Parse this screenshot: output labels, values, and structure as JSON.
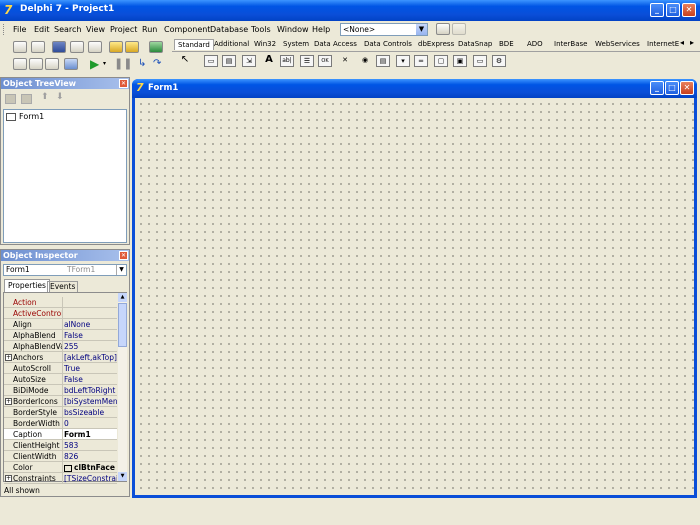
{
  "window": {
    "title": "Delphi 7 - Project1",
    "controls": [
      "_",
      "□",
      "X"
    ]
  },
  "menu": [
    "File",
    "Edit",
    "Search",
    "View",
    "Project",
    "Run",
    "Component",
    "Database",
    "Tools",
    "Window",
    "Help"
  ],
  "config_combo": {
    "value": "<None>"
  },
  "palette": {
    "tabs": [
      "Standard",
      "Additional",
      "Win32",
      "System",
      "Data Access",
      "Data Controls",
      "dbExpress",
      "DataSnap",
      "BDE",
      "ADO",
      "InterBase",
      "WebServices",
      "InternetExpress"
    ],
    "active_tab": "Standard",
    "icons": [
      "pointer-icon",
      "frames-icon",
      "mainmenu-icon",
      "popupmenu-icon",
      "label-icon",
      "edit-icon",
      "memo-icon",
      "button-icon",
      "checkbox-icon",
      "radiobutton-icon",
      "listbox-icon",
      "combobox-icon",
      "scrollbar-icon",
      "groupbox-icon",
      "radiogroup-icon",
      "panel-icon",
      "actionlist-icon"
    ],
    "icon_glyphs": [
      "↖",
      "▭",
      "▤",
      "⇲",
      "A",
      "ab|",
      "☰",
      "OK",
      "✕",
      "◉",
      "▤",
      "▾",
      "═",
      "▢",
      "▣",
      "▭",
      "⚙"
    ]
  },
  "tree_view": {
    "title": "Object TreeView",
    "items": [
      "Form1"
    ]
  },
  "inspector": {
    "title": "Object Inspector",
    "object_name": "Form1",
    "object_class": "TForm1",
    "tabs": [
      "Properties",
      "Events"
    ],
    "active_tab": "Properties",
    "properties": [
      {
        "name": "Action",
        "value": "",
        "event": true,
        "expander": false,
        "bold": false
      },
      {
        "name": "ActiveControl",
        "value": "",
        "event": true,
        "expander": false,
        "bold": false
      },
      {
        "name": "Align",
        "value": "alNone",
        "event": false,
        "expander": false,
        "bold": false
      },
      {
        "name": "AlphaBlend",
        "value": "False",
        "event": false,
        "expander": false,
        "bold": false
      },
      {
        "name": "AlphaBlendValu",
        "value": "255",
        "event": false,
        "expander": false,
        "bold": false
      },
      {
        "name": "Anchors",
        "value": "[akLeft,akTop]",
        "event": false,
        "expander": true,
        "bold": false
      },
      {
        "name": "AutoScroll",
        "value": "True",
        "event": false,
        "expander": false,
        "bold": false
      },
      {
        "name": "AutoSize",
        "value": "False",
        "event": false,
        "expander": false,
        "bold": false
      },
      {
        "name": "BiDiMode",
        "value": "bdLeftToRight",
        "event": false,
        "expander": false,
        "bold": false
      },
      {
        "name": "BorderIcons",
        "value": "[biSystemMenu,",
        "event": false,
        "expander": true,
        "bold": false
      },
      {
        "name": "BorderStyle",
        "value": "bsSizeable",
        "event": false,
        "expander": false,
        "bold": false
      },
      {
        "name": "BorderWidth",
        "value": "0",
        "event": false,
        "expander": false,
        "bold": false
      },
      {
        "name": "Caption",
        "value": "Form1",
        "event": false,
        "expander": false,
        "bold": true
      },
      {
        "name": "ClientHeight",
        "value": "583",
        "event": false,
        "expander": false,
        "bold": false
      },
      {
        "name": "ClientWidth",
        "value": "826",
        "event": false,
        "expander": false,
        "bold": false
      },
      {
        "name": "Color",
        "value": "clBtnFace",
        "event": false,
        "expander": false,
        "bold": true
      },
      {
        "name": "Constraints",
        "value": "[TSizeConstrain",
        "event": false,
        "expander": true,
        "bold": false
      }
    ],
    "status": "All shown"
  },
  "form": {
    "title": "Form1",
    "controls": [
      "_",
      "□",
      "X"
    ]
  },
  "colors": {
    "titlebar": "#0055e5",
    "face": "#ece9d8",
    "panel_title": "#6d8fd0"
  }
}
